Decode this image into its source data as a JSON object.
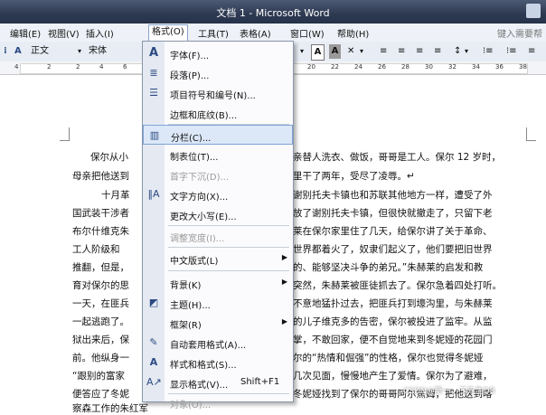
{
  "window": {
    "title": "文档 1 - Microsoft Word"
  },
  "menubar": {
    "items": [
      "编辑(E)",
      "视图(V)",
      "插入(I)",
      "格式(O)",
      "工具(T)",
      "表格(A)",
      "窗口(W)",
      "帮助(H)"
    ],
    "help_hint": "键入需要帮"
  },
  "toolbar": {
    "style_value": "正文",
    "font_value": "宋体"
  },
  "ruler": {
    "ticks": [
      "4",
      "2",
      "2",
      "4",
      "6",
      "20",
      "22",
      "24",
      "26",
      "28",
      "30",
      "32",
      "34",
      "36",
      "38"
    ]
  },
  "format_menu": {
    "items": [
      {
        "label": "字体(F)...",
        "icon": "font-A-icon"
      },
      {
        "label": "段落(P)...",
        "icon": "paragraph-icon"
      },
      {
        "label": "项目符号和编号(N)...",
        "icon": "bullets-icon"
      },
      {
        "label": "边框和底纹(B)...",
        "icon": ""
      },
      {
        "label": "分栏(C)...",
        "icon": "columns-icon",
        "highlighted": true
      },
      {
        "label": "制表位(T)...",
        "icon": ""
      },
      {
        "label": "首字下沉(D)...",
        "icon": "",
        "disabled": true
      },
      {
        "label": "文字方向(X)...",
        "icon": "text-direction-icon"
      },
      {
        "label": "更改大小写(E)...",
        "icon": ""
      },
      {
        "label": "调整宽度(I)...",
        "icon": "",
        "disabled": true
      },
      {
        "label": "中文版式(L)",
        "icon": "",
        "submenu": true
      },
      {
        "label": "背景(K)",
        "icon": "",
        "submenu": true
      },
      {
        "label": "主题(H)...",
        "icon": "theme-icon"
      },
      {
        "label": "框架(R)",
        "icon": "",
        "submenu": true
      },
      {
        "label": "自动套用格式(A)...",
        "icon": "autoformat-icon"
      },
      {
        "label": "样式和格式(S)...",
        "icon": "styles-icon"
      },
      {
        "label": "显示格式(V)...",
        "icon": "reveal-format-icon",
        "shortcut": "Shift+F1"
      },
      {
        "label": "对象(O)...",
        "icon": "",
        "disabled": true
      }
    ]
  },
  "document": {
    "lines": [
      "保尔从小",
      "母亲把他送到",
      "十月革",
      "国武装干涉者",
      "布尔什维克朱",
      "工人阶级和",
      "推翻，但是，",
      "育对保尔的思",
      "一天，在匪兵",
      "一起逃跑了。",
      "狱出来后，保",
      "前。他纵身一",
      "“跟别的富家",
      "便答应了冬妮"
    ],
    "lines_right": [
      "亲替人洗衣、做饭，哥哥是工人。保尔 12 岁时，",
      "里干了两年，受尽了凌辱。↵",
      "谢别托夫卡镇也和苏联其他地方一样，遭受了外",
      "放了谢别托夫卡镇，但很快就撤走了，只留下老",
      "莱在保尔家里住了几天，给保尔讲了关于革命、",
      "世界都着火了，奴隶们起义了，他们要把旧世界",
      "的、能够坚决斗争的弟兄。”朱赫莱的启发和教",
      "突然，朱赫莱被匪徒抓去了。保尔急着四处打听。",
      "不意地猛扑过去，把匪兵打到壕沟里，与朱赫莱",
      "的儿子维克多的告密，保尔被投进了监牢。从监",
      "掌，不敢回家，便不自觉地来到冬妮娅的花园门",
      "尔的“热情和倔强”的性格，保尔也觉得冬妮娅",
      "几次见面，慢慢地产生了爱情。保尔为了避难，",
      "冬妮娅找到了保尔的哥哥阿尔焦姆，把他送到喀"
    ],
    "line_last": "察森工作的朱红军"
  },
  "watermark": "CSDN@新一，三先生DB"
}
